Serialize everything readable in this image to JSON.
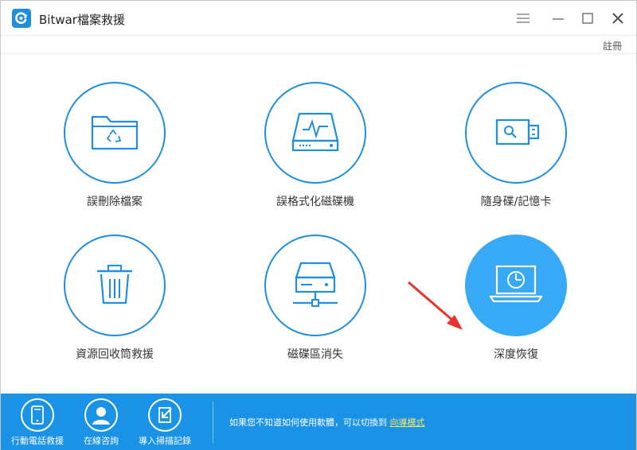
{
  "window": {
    "title": "Bitwar檔案救援",
    "register_label": "註冊"
  },
  "features": [
    {
      "id": "deleted-files",
      "label": "誤刪除檔案",
      "icon": "folder-recycle-icon"
    },
    {
      "id": "formatted-drive",
      "label": "誤格式化磁碟機",
      "icon": "hard-drive-pulse-icon"
    },
    {
      "id": "removable",
      "label": "隨身碟/記憶卡",
      "icon": "usb-drive-icon"
    },
    {
      "id": "recycle-bin",
      "label": "資源回收筒救援",
      "icon": "trash-icon"
    },
    {
      "id": "lost-partition",
      "label": "磁碟區消失",
      "icon": "server-icon"
    },
    {
      "id": "deep-recovery",
      "label": "深度恢復",
      "icon": "laptop-clock-icon",
      "selected": true
    }
  ],
  "footer": {
    "items": [
      {
        "label": "行動電話救援",
        "icon": "phone-icon"
      },
      {
        "label": "在線咨詢",
        "icon": "user-icon"
      },
      {
        "label": "導入掃描記錄",
        "icon": "import-icon"
      }
    ],
    "hint_text": "如果您不知道如何使用軟體，可以切換到",
    "wizard_link": "向導模式"
  },
  "colors": {
    "accent": "#1e8fdf",
    "footer_bg": "#1a93e6",
    "selected_bg": "#38a9f4",
    "link_yellow": "#ffe65a",
    "annotation_arrow": "#e8322b"
  }
}
